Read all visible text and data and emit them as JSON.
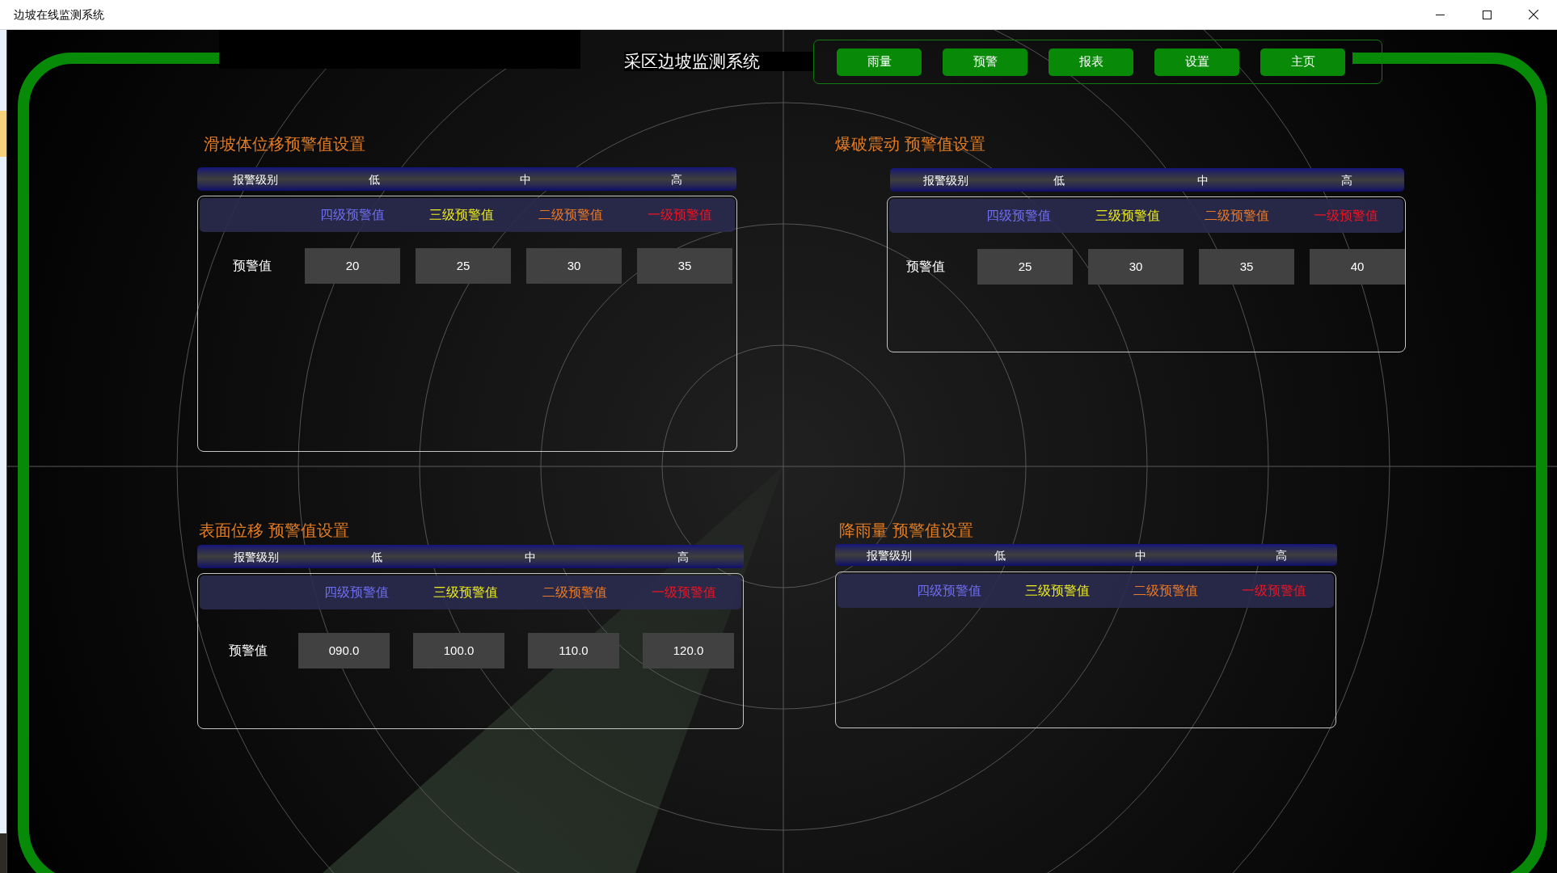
{
  "window": {
    "title": "边坡在线监测系统"
  },
  "header": {
    "title": "采区边坡监测系统",
    "nav": [
      "雨量",
      "预警",
      "报表",
      "设置",
      "主页"
    ]
  },
  "panels": [
    {
      "title": "滑坡体位移预警值设置",
      "columns": [
        "报警级别",
        "低",
        "中",
        "高"
      ],
      "levels": [
        {
          "label": "四级预警值",
          "color": "#6e6ef0"
        },
        {
          "label": "三级预警值",
          "color": "#eaea1e"
        },
        {
          "label": "二级预警值",
          "color": "#ec7a24"
        },
        {
          "label": "一级预警值",
          "color": "#ee1422"
        }
      ],
      "row_label": "预警值",
      "values": [
        "20",
        "25",
        "30",
        "35"
      ]
    },
    {
      "title": "爆破震动 预警值设置",
      "columns": [
        "报警级别",
        "低",
        "中",
        "高"
      ],
      "levels": [
        {
          "label": "四级预警值",
          "color": "#6e6ef0"
        },
        {
          "label": "三级预警值",
          "color": "#eaea1e"
        },
        {
          "label": "二级预警值",
          "color": "#ec7a24"
        },
        {
          "label": "一级预警值",
          "color": "#ee1422"
        }
      ],
      "row_label": "预警值",
      "values": [
        "25",
        "30",
        "35",
        "40"
      ]
    },
    {
      "title": "表面位移 预警值设置",
      "columns": [
        "报警级别",
        "低",
        "中",
        "高"
      ],
      "levels": [
        {
          "label": "四级预警值",
          "color": "#6e6ef0"
        },
        {
          "label": "三级预警值",
          "color": "#eaea1e"
        },
        {
          "label": "二级预警值",
          "color": "#ec7a24"
        },
        {
          "label": "一级预警值",
          "color": "#ee1422"
        }
      ],
      "row_label": "预警值",
      "values": [
        "090.0",
        "100.0",
        "110.0",
        "120.0"
      ]
    },
    {
      "title": "降雨量 预警值设置",
      "columns": [
        "报警级别",
        "低",
        "中",
        "高"
      ],
      "levels": [
        {
          "label": "四级预警值",
          "color": "#6e6ef0"
        },
        {
          "label": "三级预警值",
          "color": "#eaea1e"
        },
        {
          "label": "二级预警值",
          "color": "#ec7a24"
        },
        {
          "label": "一级预警值",
          "color": "#ee1422"
        }
      ]
    }
  ]
}
